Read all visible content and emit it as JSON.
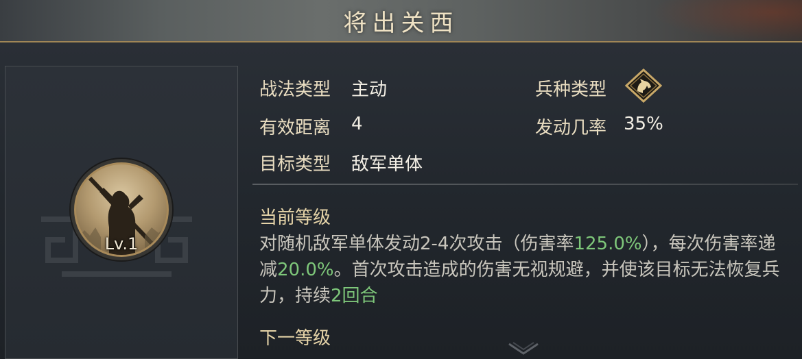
{
  "title": "将出关西",
  "portrait": {
    "level": "Lv.1"
  },
  "attributes": {
    "tactic_type_label": "战法类型",
    "tactic_type_value": "主动",
    "troop_type_label": "兵种类型",
    "troop_type_icon": "cavalry-horse-icon",
    "range_label": "有效距离",
    "range_value": "4",
    "trigger_rate_label": "发动几率",
    "trigger_rate_value": "35%",
    "target_type_label": "目标类型",
    "target_type_value": "敌军单体"
  },
  "current_level": {
    "heading": "当前等级",
    "description": [
      {
        "text": "对随机敌军单体发动2-4次攻击（伤害率",
        "highlight": false
      },
      {
        "text": "125.0%",
        "highlight": true
      },
      {
        "text": "），每次伤害率递减",
        "highlight": false
      },
      {
        "text": "20.0%",
        "highlight": true
      },
      {
        "text": "。首次攻击造成的伤害无视规避，并使该目标无法恢复兵力，持续",
        "highlight": false
      },
      {
        "text": "2回合",
        "highlight": true
      }
    ]
  },
  "next_level": {
    "heading": "下一等级"
  },
  "colors": {
    "accent_gold": "#a08656",
    "highlight_green": "#7ec77a",
    "label_text": "#e8dcc0",
    "body_text": "#c9c6bd"
  }
}
